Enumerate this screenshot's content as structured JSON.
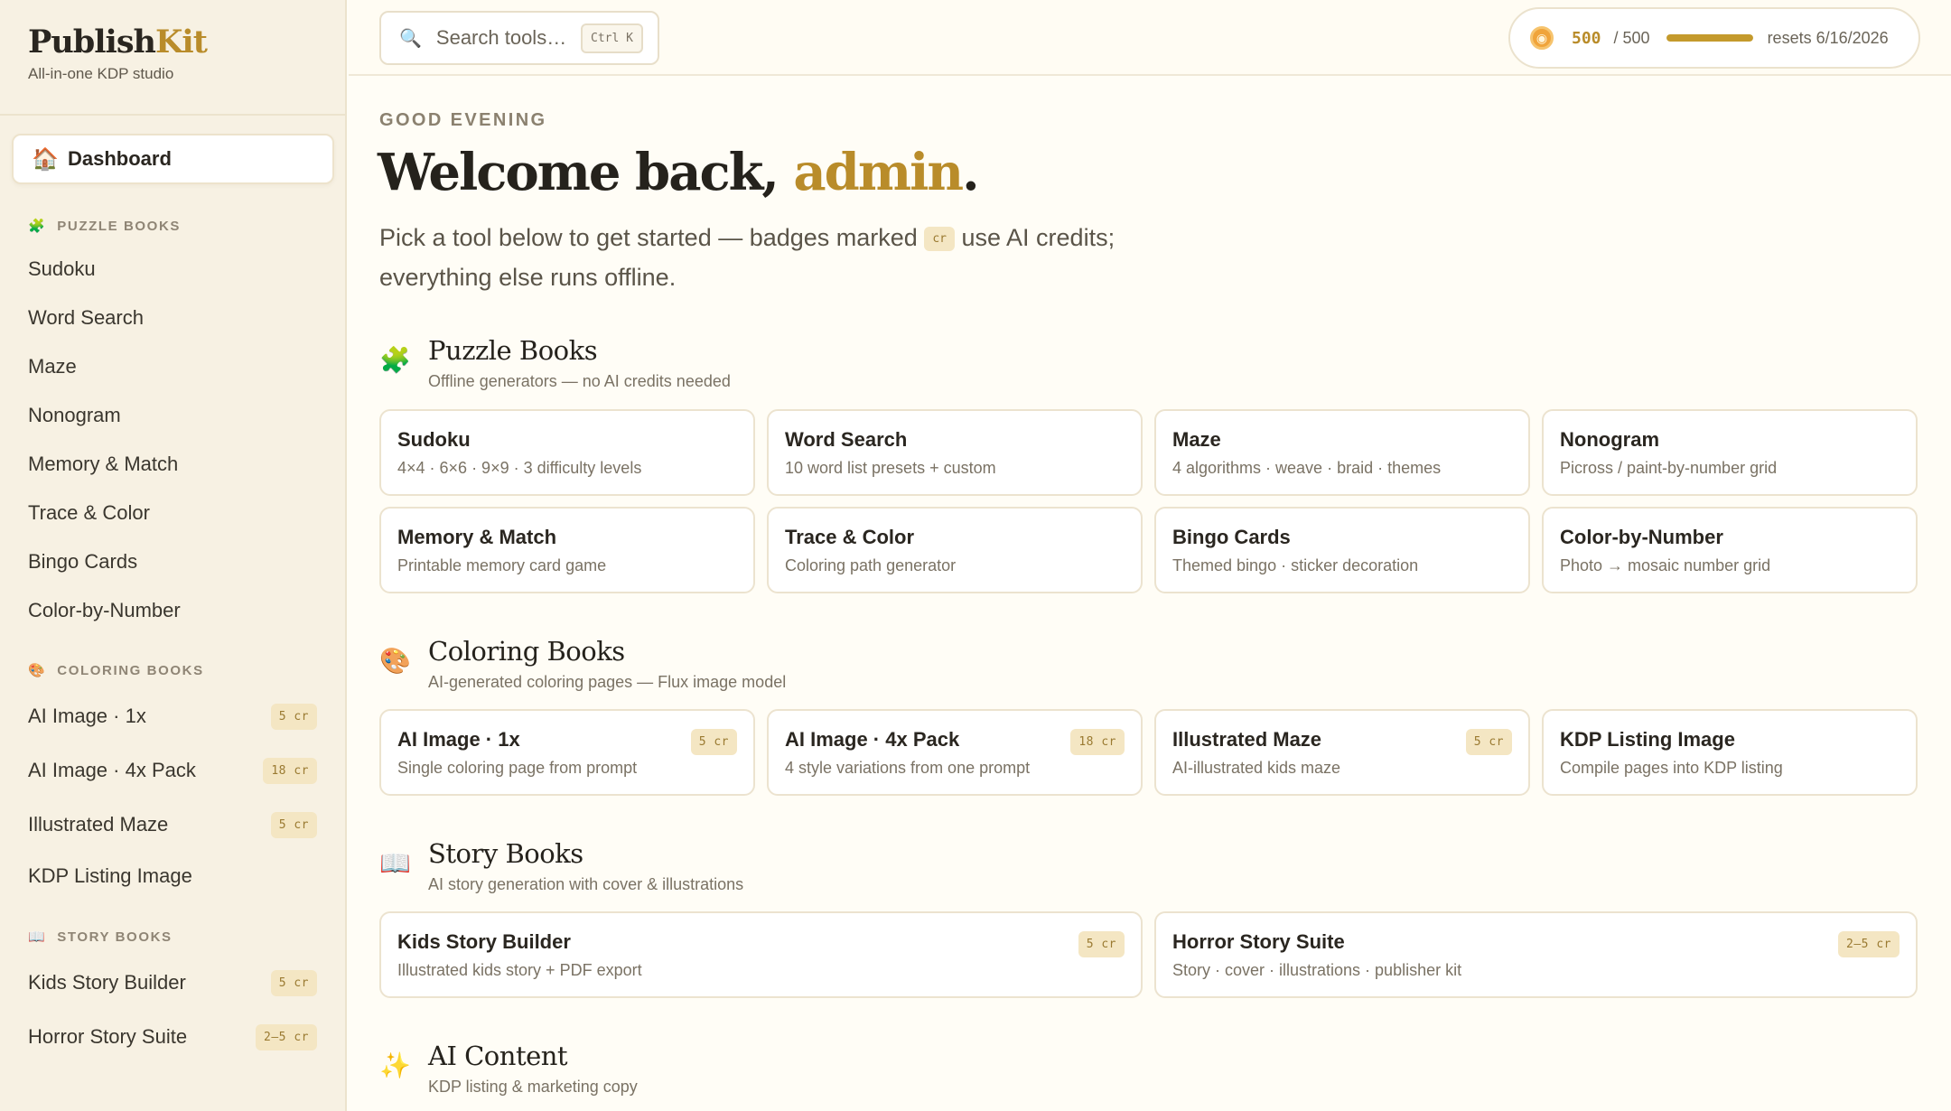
{
  "brand": {
    "name_a": "Publish",
    "name_b": "Kit",
    "tagline": "All-in-one KDP studio"
  },
  "sidebar": {
    "dashboard": {
      "icon": "🏠",
      "label": "Dashboard"
    },
    "sections": [
      {
        "icon": "🧩",
        "label": "PUZZLE BOOKS",
        "items": [
          {
            "label": "Sudoku"
          },
          {
            "label": "Word Search"
          },
          {
            "label": "Maze"
          },
          {
            "label": "Nonogram"
          },
          {
            "label": "Memory & Match"
          },
          {
            "label": "Trace & Color"
          },
          {
            "label": "Bingo Cards"
          },
          {
            "label": "Color-by-Number"
          }
        ]
      },
      {
        "icon": "🎨",
        "label": "COLORING BOOKS",
        "items": [
          {
            "label": "AI Image · 1x",
            "badge": "5 cr"
          },
          {
            "label": "AI Image · 4x Pack",
            "badge": "18 cr"
          },
          {
            "label": "Illustrated Maze",
            "badge": "5 cr"
          },
          {
            "label": "KDP Listing Image"
          }
        ]
      },
      {
        "icon": "📖",
        "label": "STORY BOOKS",
        "items": [
          {
            "label": "Kids Story Builder",
            "badge": "5 cr"
          },
          {
            "label": "Horror Story Suite",
            "badge": "2–5 cr"
          }
        ]
      }
    ]
  },
  "topbar": {
    "search": {
      "placeholder": "Search tools…",
      "shortcut": "Ctrl K",
      "icon": "search-icon"
    },
    "credits": {
      "coin": "◉",
      "used": "500",
      "total": "/ 500",
      "fraction": 1.0,
      "reset": "resets 6/16/2026"
    }
  },
  "main": {
    "greeting": "GOOD EVENING",
    "welcome_prefix": "Welcome back, ",
    "user": "admin",
    "welcome_suffix": ".",
    "intro_a": "Pick a tool below to get started — badges marked ",
    "intro_badge": "cr",
    "intro_b": " use AI credits; everything else runs offline."
  },
  "groups": [
    {
      "icon": "🧩",
      "title": "Puzzle Books",
      "subtitle": "Offline generators — no AI credits needed",
      "cards": [
        {
          "title": "Sudoku",
          "desc": "4×4 · 6×6 · 9×9 · 3 difficulty levels"
        },
        {
          "title": "Word Search",
          "desc": "10 word list presets + custom"
        },
        {
          "title": "Maze",
          "desc": "4 algorithms · weave · braid · themes"
        },
        {
          "title": "Nonogram",
          "desc": "Picross / paint-by-number grid"
        },
        {
          "title": "Memory & Match",
          "desc": "Printable memory card game"
        },
        {
          "title": "Trace & Color",
          "desc": "Coloring path generator"
        },
        {
          "title": "Bingo Cards",
          "desc": "Themed bingo · sticker decoration"
        },
        {
          "title": "Color-by-Number",
          "desc": "Photo → mosaic number grid"
        }
      ]
    },
    {
      "icon": "🎨",
      "title": "Coloring Books",
      "subtitle": "AI-generated coloring pages — Flux image model",
      "cards": [
        {
          "title": "AI Image · 1x",
          "desc": "Single coloring page from prompt",
          "badge": "5 cr"
        },
        {
          "title": "AI Image · 4x Pack",
          "desc": "4 style variations from one prompt",
          "badge": "18 cr"
        },
        {
          "title": "Illustrated Maze",
          "desc": "AI-illustrated kids maze",
          "badge": "5 cr"
        },
        {
          "title": "KDP Listing Image",
          "desc": "Compile pages into KDP listing"
        }
      ]
    },
    {
      "icon": "📖",
      "title": "Story Books",
      "subtitle": "AI story generation with cover & illustrations",
      "cards": [
        {
          "title": "Kids Story Builder",
          "desc": "Illustrated kids story + PDF export",
          "badge": "5 cr"
        },
        {
          "title": "Horror Story Suite",
          "desc": "Story · cover · illustrations · publisher kit",
          "badge": "2–5 cr"
        }
      ]
    },
    {
      "icon": "✨",
      "title": "AI Content",
      "subtitle": "KDP listing & marketing copy",
      "cards": []
    }
  ]
}
